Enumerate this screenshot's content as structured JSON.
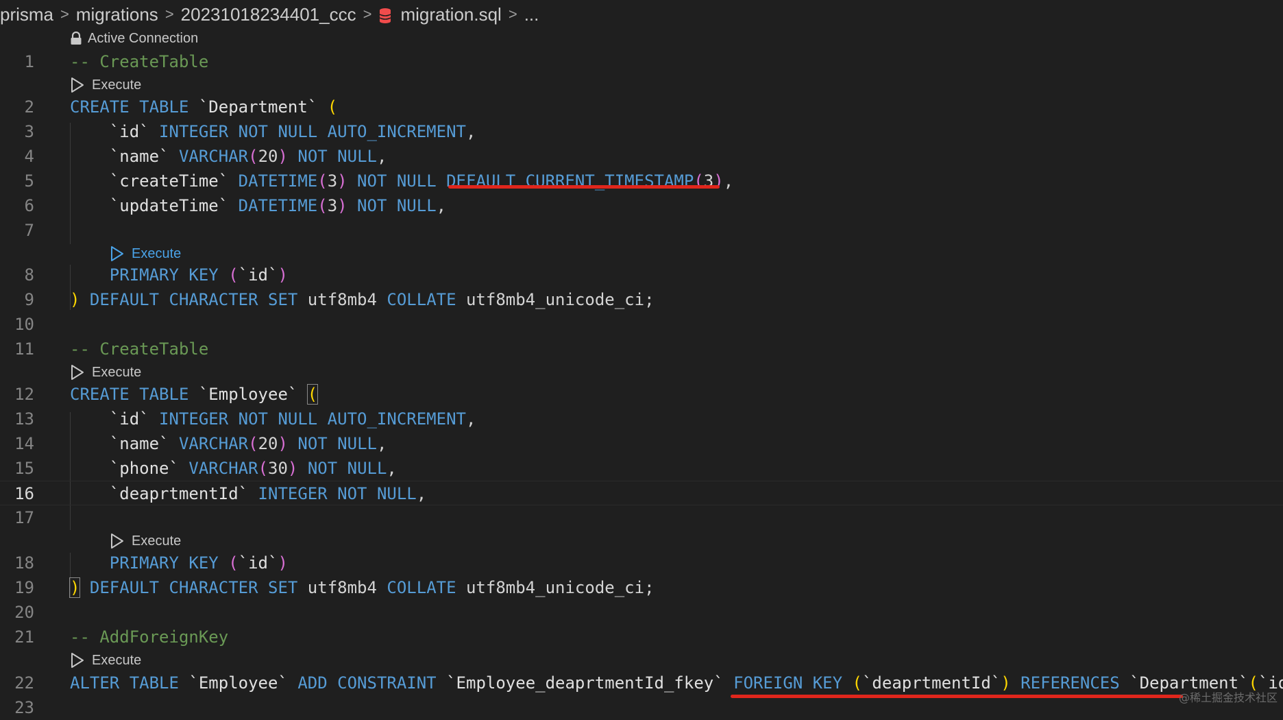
{
  "breadcrumb": {
    "items": [
      "prisma",
      "migrations",
      "20231018234401_ccc",
      "migration.sql",
      "..."
    ],
    "separator": ">"
  },
  "codelens": {
    "active_connection": "Active Connection",
    "execute": "Execute"
  },
  "lines": {
    "1": {
      "num": "1",
      "tokens": [
        [
          "cm",
          "-- CreateTable"
        ]
      ]
    },
    "2": {
      "num": "2",
      "tokens": [
        [
          "kw",
          "CREATE TABLE "
        ],
        [
          "idn",
          "`Department`"
        ],
        [
          "tx",
          " "
        ],
        [
          "p1",
          "("
        ]
      ]
    },
    "3": {
      "num": "3",
      "tokens": [
        [
          "tx",
          "    "
        ],
        [
          "idn",
          "`id`"
        ],
        [
          "tx",
          " "
        ],
        [
          "kw",
          "INTEGER NOT NULL AUTO_INCREMENT"
        ],
        [
          "tx",
          ","
        ]
      ]
    },
    "4": {
      "num": "4",
      "tokens": [
        [
          "tx",
          "    "
        ],
        [
          "idn",
          "`name`"
        ],
        [
          "tx",
          " "
        ],
        [
          "kw",
          "VARCHAR"
        ],
        [
          "p2",
          "("
        ],
        [
          "num",
          "20"
        ],
        [
          "p2",
          ")"
        ],
        [
          "tx",
          " "
        ],
        [
          "kw",
          "NOT NULL"
        ],
        [
          "tx",
          ","
        ]
      ]
    },
    "5": {
      "num": "5",
      "tokens": [
        [
          "tx",
          "    "
        ],
        [
          "idn",
          "`createTime`"
        ],
        [
          "tx",
          " "
        ],
        [
          "kw",
          "DATETIME"
        ],
        [
          "p2",
          "("
        ],
        [
          "num",
          "3"
        ],
        [
          "p2",
          ")"
        ],
        [
          "tx",
          " "
        ],
        [
          "kw",
          "NOT NULL DEFAULT CURRENT_TIMESTAMP"
        ],
        [
          "p2",
          "("
        ],
        [
          "num",
          "3"
        ],
        [
          "p2",
          ")"
        ],
        [
          "tx",
          ","
        ]
      ]
    },
    "6": {
      "num": "6",
      "tokens": [
        [
          "tx",
          "    "
        ],
        [
          "idn",
          "`updateTime`"
        ],
        [
          "tx",
          " "
        ],
        [
          "kw",
          "DATETIME"
        ],
        [
          "p2",
          "("
        ],
        [
          "num",
          "3"
        ],
        [
          "p2",
          ")"
        ],
        [
          "tx",
          " "
        ],
        [
          "kw",
          "NOT NULL"
        ],
        [
          "tx",
          ","
        ]
      ]
    },
    "7": {
      "num": "7",
      "tokens": []
    },
    "8": {
      "num": "8",
      "tokens": [
        [
          "tx",
          "    "
        ],
        [
          "kw",
          "PRIMARY KEY "
        ],
        [
          "p2",
          "("
        ],
        [
          "idn",
          "`id`"
        ],
        [
          "p2",
          ")"
        ]
      ]
    },
    "9": {
      "num": "9",
      "tokens": [
        [
          "p1",
          ")"
        ],
        [
          "tx",
          " "
        ],
        [
          "kw",
          "DEFAULT CHARACTER SET "
        ],
        [
          "tx",
          "utf8mb4 "
        ],
        [
          "kw",
          "COLLATE "
        ],
        [
          "tx",
          "utf8mb4_unicode_ci;"
        ]
      ]
    },
    "10": {
      "num": "10",
      "tokens": []
    },
    "11": {
      "num": "11",
      "tokens": [
        [
          "cm",
          "-- CreateTable"
        ]
      ]
    },
    "12": {
      "num": "12",
      "tokens": [
        [
          "kw",
          "CREATE TABLE "
        ],
        [
          "idn",
          "`Employee`"
        ],
        [
          "tx",
          " "
        ],
        [
          "p1b",
          "("
        ]
      ]
    },
    "13": {
      "num": "13",
      "tokens": [
        [
          "tx",
          "    "
        ],
        [
          "idn",
          "`id`"
        ],
        [
          "tx",
          " "
        ],
        [
          "kw",
          "INTEGER NOT NULL AUTO_INCREMENT"
        ],
        [
          "tx",
          ","
        ]
      ]
    },
    "14": {
      "num": "14",
      "tokens": [
        [
          "tx",
          "    "
        ],
        [
          "idn",
          "`name`"
        ],
        [
          "tx",
          " "
        ],
        [
          "kw",
          "VARCHAR"
        ],
        [
          "p2",
          "("
        ],
        [
          "num",
          "20"
        ],
        [
          "p2",
          ")"
        ],
        [
          "tx",
          " "
        ],
        [
          "kw",
          "NOT NULL"
        ],
        [
          "tx",
          ","
        ]
      ]
    },
    "15": {
      "num": "15",
      "tokens": [
        [
          "tx",
          "    "
        ],
        [
          "idn",
          "`phone`"
        ],
        [
          "tx",
          " "
        ],
        [
          "kw",
          "VARCHAR"
        ],
        [
          "p2",
          "("
        ],
        [
          "num",
          "30"
        ],
        [
          "p2",
          ")"
        ],
        [
          "tx",
          " "
        ],
        [
          "kw",
          "NOT NULL"
        ],
        [
          "tx",
          ","
        ]
      ]
    },
    "16": {
      "num": "16",
      "tokens": [
        [
          "tx",
          "    "
        ],
        [
          "idn",
          "`deaprtmentId`"
        ],
        [
          "tx",
          " "
        ],
        [
          "kw",
          "INTEGER NOT NULL"
        ],
        [
          "tx",
          ","
        ]
      ]
    },
    "17": {
      "num": "17",
      "tokens": []
    },
    "18": {
      "num": "18",
      "tokens": [
        [
          "tx",
          "    "
        ],
        [
          "kw",
          "PRIMARY KEY "
        ],
        [
          "p2",
          "("
        ],
        [
          "idn",
          "`id`"
        ],
        [
          "p2",
          ")"
        ]
      ]
    },
    "19": {
      "num": "19",
      "tokens": [
        [
          "p1b",
          ")"
        ],
        [
          "tx",
          " "
        ],
        [
          "kw",
          "DEFAULT CHARACTER SET "
        ],
        [
          "tx",
          "utf8mb4 "
        ],
        [
          "kw",
          "COLLATE "
        ],
        [
          "tx",
          "utf8mb4_unicode_ci;"
        ]
      ]
    },
    "20": {
      "num": "20",
      "tokens": []
    },
    "21": {
      "num": "21",
      "tokens": [
        [
          "cm",
          "-- AddForeignKey"
        ]
      ]
    },
    "22": {
      "num": "22",
      "tokens": [
        [
          "kw",
          "ALTER TABLE "
        ],
        [
          "idn",
          "`Employee`"
        ],
        [
          "tx",
          " "
        ],
        [
          "kw",
          "ADD CONSTRAINT "
        ],
        [
          "idn",
          "`Employee_deaprtmentId_fkey`"
        ],
        [
          "tx",
          " "
        ],
        [
          "kw",
          "FOREIGN KEY "
        ],
        [
          "p1",
          "("
        ],
        [
          "idn",
          "`deaprtmentId`"
        ],
        [
          "p1",
          ")"
        ],
        [
          "tx",
          " "
        ],
        [
          "kw",
          "REFERENCES "
        ],
        [
          "idn",
          "`Department`"
        ],
        [
          "p1",
          "("
        ],
        [
          "idn",
          "`id"
        ]
      ]
    },
    "23": {
      "num": "23",
      "tokens": []
    }
  },
  "current_line": "16",
  "watermark": "@稀土掘金技术社区",
  "colors": {
    "background": "#1f1f1f",
    "keyword": "#569cd6",
    "comment": "#6a9955",
    "bracket_1": "#ffd700",
    "bracket_2": "#da70d6",
    "annotation_underline": "#e0261c",
    "db_icon": "#f14c4c"
  }
}
